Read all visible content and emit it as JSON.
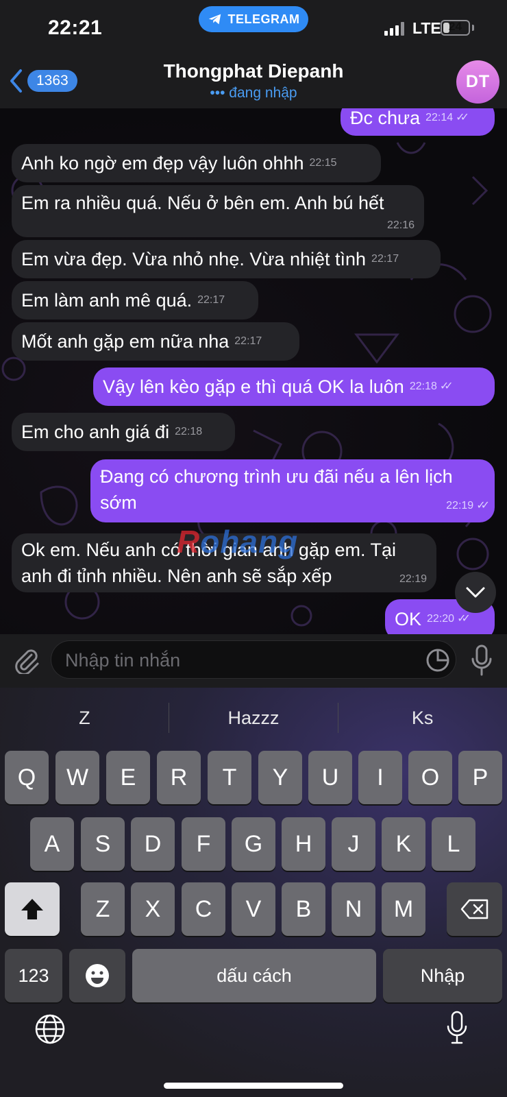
{
  "status_bar": {
    "time": "22:21",
    "app_pill": "TELEGRAM",
    "network": "LTE",
    "battery": "24"
  },
  "header": {
    "unread_count": "1363",
    "contact_name": "Thongphat Diepanh",
    "contact_status": "••• đang nhập",
    "avatar_initials": "DT"
  },
  "messages": [
    {
      "dir": "out",
      "text": "Đc chưa",
      "time": "22:14",
      "read": true
    },
    {
      "dir": "in",
      "text": "Anh ko ngờ em đẹp vậy luôn ohhh",
      "time": "22:15"
    },
    {
      "dir": "in",
      "text": "Em ra nhiều quá. Nếu ở bên em. Anh bú hết",
      "time": "22:16"
    },
    {
      "dir": "in",
      "text": "Em vừa đẹp. Vừa nhỏ nhẹ. Vừa nhiệt tình",
      "time": "22:17"
    },
    {
      "dir": "in",
      "text": "Em làm anh mê quá.",
      "time": "22:17"
    },
    {
      "dir": "in",
      "text": "Mốt anh gặp em nữa nha",
      "time": "22:17"
    },
    {
      "dir": "out",
      "text": "Vậy lên kèo gặp e thì quá OK la luôn",
      "time": "22:18",
      "read": true
    },
    {
      "dir": "in",
      "text": "Em cho anh giá đi",
      "time": "22:18"
    },
    {
      "dir": "out",
      "text": "Đang có chương trình ưu đãi nếu a lên lịch sớm",
      "line1": "Đang có chương trình ưu đãi nếu a lên lịch",
      "line2": "sớm",
      "time": "22:19",
      "read": true
    },
    {
      "dir": "in",
      "text": "Ok em. Nếu anh có thời gian anh gặp em. Tại anh đi tỉnh nhiều. Nên anh sẽ sắp xếp",
      "line1": "Ok em. Nếu anh có thời gian anh gặp em. Tại",
      "line2": "anh đi tỉnh nhiều. Nên anh sẽ sắp xếp",
      "time": "22:19"
    },
    {
      "dir": "out",
      "text": "OK",
      "time": "22:20",
      "read": true
    }
  ],
  "watermark": {
    "first": "R",
    "rest": "ohang"
  },
  "input": {
    "placeholder": "Nhập tin nhắn",
    "value": ""
  },
  "keyboard": {
    "suggestions": [
      "Z",
      "Hazzz",
      "Ks"
    ],
    "row1": [
      "Q",
      "W",
      "E",
      "R",
      "T",
      "Y",
      "U",
      "I",
      "O",
      "P"
    ],
    "row2": [
      "A",
      "S",
      "D",
      "F",
      "G",
      "H",
      "J",
      "K",
      "L"
    ],
    "row3": [
      "Z",
      "X",
      "C",
      "V",
      "B",
      "N",
      "M"
    ],
    "numbers_key": "123",
    "space_key": "dấu cách",
    "return_key": "Nhập"
  },
  "colors": {
    "accent": "#8a4cf2",
    "link": "#4a9cf2",
    "badge": "#3d86e6",
    "telegram": "#2f8bf5",
    "incoming": "#242428"
  },
  "icons": [
    "telegram-icon",
    "back-chevron-icon",
    "attach-icon",
    "sticker-icon",
    "mic-icon",
    "chevron-down-icon",
    "shift-icon",
    "backspace-icon",
    "emoji-icon",
    "globe-icon",
    "dictation-icon"
  ]
}
